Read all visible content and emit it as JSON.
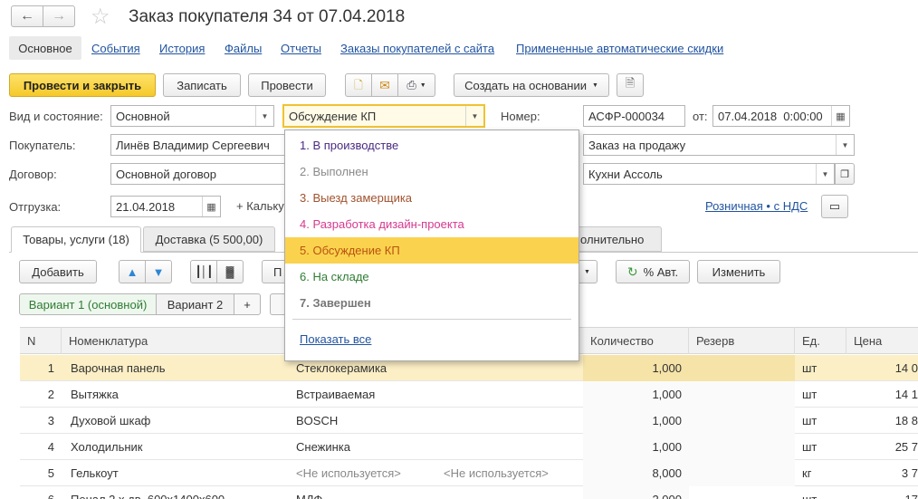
{
  "window": {
    "title": "Заказ покупателя 34 от 07.04.2018"
  },
  "nav_tabs": [
    "Основное",
    "События",
    "История",
    "Файлы",
    "Отчеты",
    "Заказы покупателей с сайта",
    "Примененные автоматические скидки"
  ],
  "toolbar": {
    "post_close": "Провести и закрыть",
    "save": "Записать",
    "post": "Провести",
    "create_based": "Создать на основании"
  },
  "form": {
    "kind_label": "Вид и состояние:",
    "kind_value": "Основной",
    "state_value": "Обсуждение КП",
    "number_label": "Номер:",
    "number_value": "АСФР-000034",
    "date_label": "от:",
    "date_value": "07.04.2018  0:00:00",
    "customer_label": "Покупатель:",
    "customer_value": "Линёв Владимир Сергеевич",
    "order_type_value": "Заказ на продажу",
    "contract_label": "Договор:",
    "contract_value": "Основной договор",
    "company_value": "Кухни Ассоль",
    "shipment_label": "Отгрузка:",
    "shipment_value": "21.04.2018",
    "calc_label": "+ Кальку",
    "price_type_link": "Розничная • с НДС"
  },
  "content_tabs": {
    "goods": "Товары, услуги (18)",
    "delivery": "Доставка (5 500,00)",
    "extra": "олнительно"
  },
  "table_toolbar": {
    "add": "Добавить",
    "partial": "П",
    "auto_pct": "% Авт.",
    "change": "Изменить"
  },
  "variants": {
    "v1": "Вариант 1 (основной)",
    "v2": "Вариант 2",
    "plus": "+"
  },
  "table": {
    "headers": {
      "n": "N",
      "item": "Номенклатура",
      "qty": "Количество",
      "reserve": "Резерв",
      "unit": "Ед.",
      "price": "Цена"
    },
    "rows": [
      {
        "n": "1",
        "item": "Варочная панель",
        "char": "Стеклокерамика",
        "batch": "",
        "qty": "1,000",
        "unit": "шт",
        "price": "14 0"
      },
      {
        "n": "2",
        "item": "Вытяжка",
        "char": "Встраиваемая",
        "batch": "",
        "qty": "1,000",
        "unit": "шт",
        "price": "14 1"
      },
      {
        "n": "3",
        "item": "Духовой шкаф",
        "char": "BOSCH",
        "batch": "",
        "qty": "1,000",
        "unit": "шт",
        "price": "18 8"
      },
      {
        "n": "4",
        "item": "Холодильник",
        "char": "Снежинка",
        "batch": "",
        "qty": "1,000",
        "unit": "шт",
        "price": "25 7"
      },
      {
        "n": "5",
        "item": "Гелькоут",
        "char": "<Не используется>",
        "batch": "<Не используется>",
        "qty": "8,000",
        "unit": "кг",
        "price": "3 7"
      },
      {
        "n": "6",
        "item": "Пенал 2 х дв. 600х1400х600",
        "char": "МДФ",
        "batch": "",
        "qty": "2,000",
        "unit": "шт",
        "price": "17"
      }
    ]
  },
  "dropdown": {
    "items": [
      {
        "label": "1. В производстве",
        "color": "#4b2a82"
      },
      {
        "label": "2. Выполнен",
        "color": "#8a8a8a"
      },
      {
        "label": "3. Выезд замерщика",
        "color": "#a0522d"
      },
      {
        "label": "4. Разработка дизайн-проекта",
        "color": "#d6398f"
      },
      {
        "label": "5. Обсуждение КП",
        "color": "#b8540f"
      },
      {
        "label": "6. На складе",
        "color": "#2e7d32"
      },
      {
        "label": "7. Завершен",
        "color": "#777777"
      }
    ],
    "show_all": "Показать все"
  }
}
